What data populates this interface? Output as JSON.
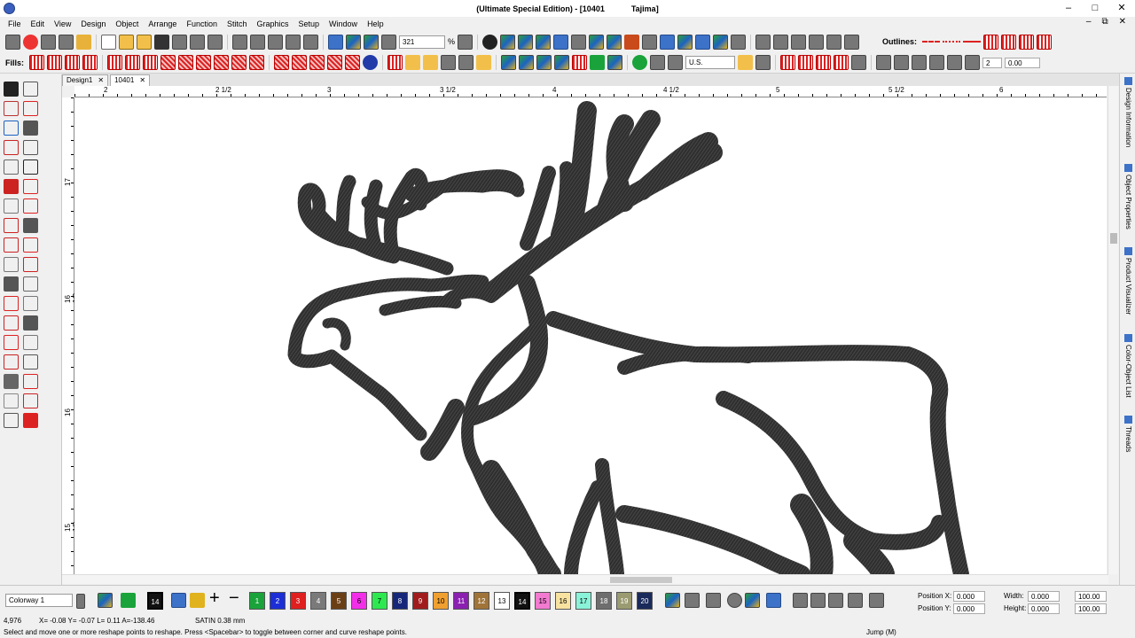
{
  "window": {
    "title": "(Ultimate Special Edition) - [10401",
    "machine": "Tajima]",
    "controls": [
      "–",
      "□",
      "✕"
    ]
  },
  "menu": {
    "items": [
      "File",
      "Edit",
      "View",
      "Design",
      "Object",
      "Arrange",
      "Function",
      "Stitch",
      "Graphics",
      "Setup",
      "Window",
      "Help"
    ],
    "mdi_controls": [
      "–",
      "⧉",
      "✕"
    ]
  },
  "toolbar": {
    "zoom_value": "321",
    "zoom_unit": "%",
    "outlines_label": "Outlines:",
    "fills_label": "Fills:",
    "unit_select": "U.S.",
    "field_a": "2",
    "field_b": "0.00"
  },
  "doc_tabs": [
    {
      "label": "Design1",
      "close": "✕"
    },
    {
      "label": "10401",
      "close": "✕"
    }
  ],
  "rulers": {
    "top": [
      "2",
      "2 1/2",
      "3",
      "3 1/2",
      "4",
      "4 1/2",
      "5",
      "5 1/2",
      "6"
    ],
    "left": [
      "17",
      "16 1/2",
      "16",
      "15 1/2"
    ]
  },
  "right_dock": [
    "Design Information",
    "Object Properties",
    "Product Visualizer",
    "Color-Object List",
    "Threads"
  ],
  "bottom": {
    "colorway": "Colorway 1",
    "current_color": "14",
    "palette": [
      {
        "n": "1",
        "c": "#1aa33a"
      },
      {
        "n": "2",
        "c": "#1c2fd6"
      },
      {
        "n": "3",
        "c": "#e01f1f"
      },
      {
        "n": "4",
        "c": "#7a7a7a"
      },
      {
        "n": "5",
        "c": "#6b3f16"
      },
      {
        "n": "6",
        "c": "#f22ee8"
      },
      {
        "n": "7",
        "c": "#2ee850"
      },
      {
        "n": "8",
        "c": "#16277a"
      },
      {
        "n": "9",
        "c": "#a11d1d"
      },
      {
        "n": "10",
        "c": "#f0a030"
      },
      {
        "n": "11",
        "c": "#8a1fb0"
      },
      {
        "n": "12",
        "c": "#a07438"
      },
      {
        "n": "13",
        "c": "#ffffff"
      },
      {
        "n": "14",
        "c": "#111111"
      },
      {
        "n": "15",
        "c": "#f27ad0"
      },
      {
        "n": "16",
        "c": "#f7e2a0"
      },
      {
        "n": "17",
        "c": "#8af2d8"
      },
      {
        "n": "18",
        "c": "#6e6e6e"
      },
      {
        "n": "19",
        "c": "#9b9b72"
      },
      {
        "n": "20",
        "c": "#1a2a5a"
      }
    ],
    "position_x_label": "Position X:",
    "position_y_label": "Position Y:",
    "position_x": "0.000",
    "position_y": "0.000",
    "width_label": "Width:",
    "height_label": "Height:",
    "width": "0.000",
    "height": "0.000",
    "scale_w": "100.00",
    "scale_h": "100.00"
  },
  "status": {
    "stitch_count": "4,976",
    "coords": "X= -0.08 Y= -0.07 L= 0.11 A=-138.46",
    "stitch_type": "SATIN 0.38 mm",
    "hint": "Select and move one or more reshape points to reshape. Press <Spacebar> to toggle between corner and curve reshape points.",
    "mode": "Jump (M)"
  },
  "colors": {
    "stitch": "#2e2e2e",
    "accent": "#d22222"
  }
}
